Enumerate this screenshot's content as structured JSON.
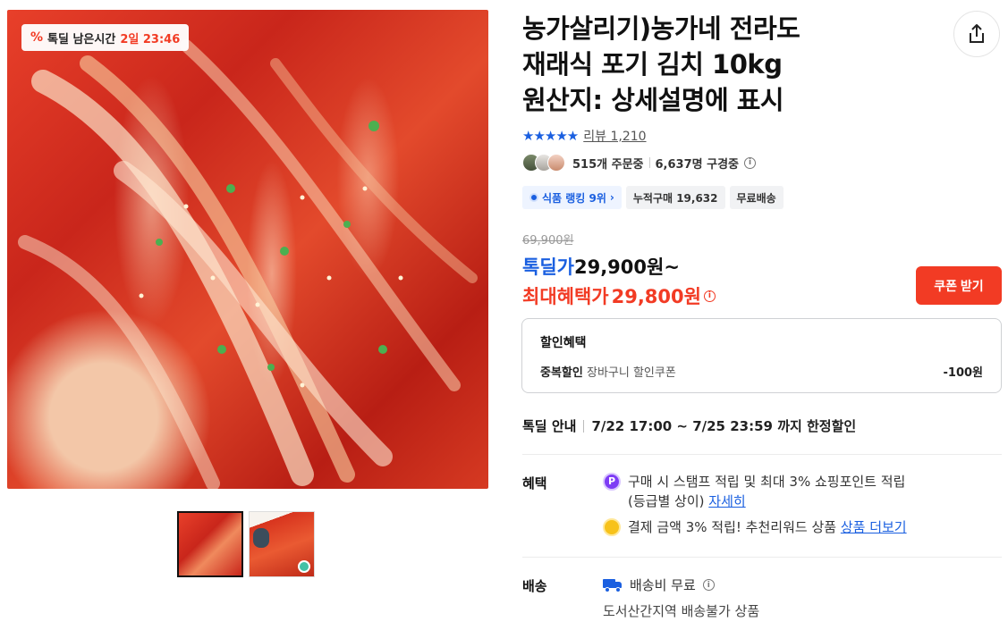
{
  "media": {
    "timer_badge": {
      "icon": "percent-icon",
      "label": "톡딜 남은시간",
      "time": "2일 23:46"
    },
    "thumbnails": [
      "thumb-kimchi-1",
      "thumb-kimchi-2"
    ]
  },
  "product": {
    "title_lines": [
      "농가살리기)농가네 전라도",
      "재래식 포기 김치 10kg",
      "원산지: 상세설명에 표시"
    ],
    "rating_stars": "★★★★★",
    "review_text": "리뷰 1,210",
    "orders_text": "515개 주문중",
    "viewers_text": "6,637명 구경중",
    "chips": {
      "rank": "식품 랭킹 9위",
      "cumulative": "누적구매 19,632",
      "shipping": "무료배송"
    }
  },
  "price": {
    "original": "69,900원",
    "deal_label": "톡딜가",
    "deal_value": "29,900원~",
    "max_label": "최대혜택가",
    "max_value": "29,800원",
    "coupon_button": "쿠폰 받기"
  },
  "discount_box": {
    "title": "할인혜택",
    "row_key": "중복할인",
    "row_key_sub": "장바구니 할인쿠폰",
    "row_value": "-100원"
  },
  "deal_info": {
    "label": "톡딜 안내",
    "period": "7/22 17:00 ~ 7/25 23:59 까지 한정할인"
  },
  "benefits": {
    "label": "혜택",
    "item1_text": "구매 시 스탬프 적립 및 최대 3% 쇼핑포인트 적립",
    "item1_line2": "(등급별 상이)",
    "item1_link": "자세히",
    "item2_text": "결제 금액 3% 적립! 추천리워드 상품",
    "item2_link": "상품 더보기",
    "badge_p": "P"
  },
  "shipping": {
    "label": "배송",
    "fee_text": "배송비 무료",
    "note": "도서산간지역 배송불가 상품"
  },
  "colors": {
    "accent_red": "#f23b24",
    "accent_blue": "#1a5fe0"
  }
}
